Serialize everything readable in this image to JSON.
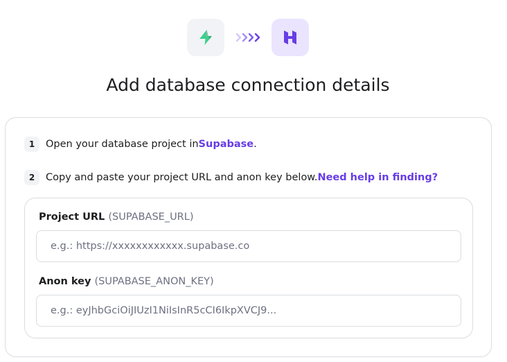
{
  "header": {
    "source_icon": "supabase-logo-icon",
    "transfer_icon": "triple-chevron-right-icon",
    "target_icon": "hostinger-logo-icon",
    "title": "Add database connection details"
  },
  "steps": [
    {
      "number": "1",
      "text": "Open your database project in ",
      "link": "Supabase",
      "suffix": "."
    },
    {
      "number": "2",
      "text": "Copy and paste your project URL and anon key below. ",
      "link": "Need help in finding?",
      "suffix": ""
    }
  ],
  "form": {
    "project_url": {
      "label": "Project URL",
      "hint": "(SUPABASE_URL)",
      "value": "",
      "placeholder": "e.g.: https://xxxxxxxxxxxx.supabase.co"
    },
    "anon_key": {
      "label": "Anon key",
      "hint": "(SUPABASE_ANON_KEY)",
      "value": "",
      "placeholder": "e.g.: eyJhbGciOiJIUzI1NiIsInR5cCI6IkpXVCJ9..."
    }
  },
  "colors": {
    "accent": "#673de6",
    "supabase_green": "#3ecf8e",
    "hostinger_purple": "#673de6",
    "border": "#dadce0",
    "muted_text": "#6d7081"
  }
}
